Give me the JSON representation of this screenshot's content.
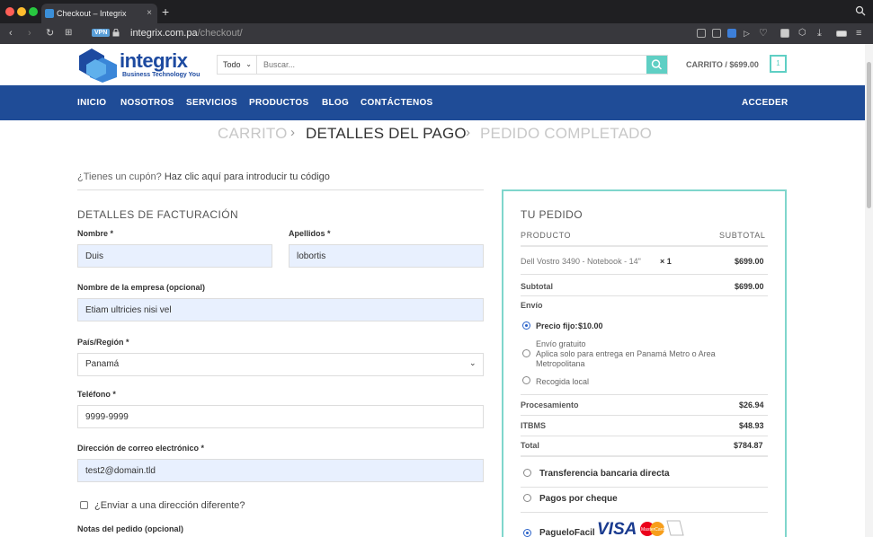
{
  "browser": {
    "tab_title": "Checkout – Integrix",
    "url_host": "integrix.com.pa",
    "url_path": "/checkout/",
    "vpn_label": "VPN"
  },
  "header": {
    "logo_text": "integrix",
    "logo_tagline": "Business Technology You",
    "search_category": "Todo",
    "search_placeholder": "Buscar...",
    "cart_label": "CARRITO / $699.00",
    "cart_count": "1"
  },
  "nav": {
    "items": [
      "INICIO",
      "NOSOTROS",
      "SERVICIOS",
      "PRODUCTOS",
      "BLOG",
      "CONTÁCTENOS"
    ],
    "login": "ACCEDER"
  },
  "steps": {
    "cart": "CARRITO",
    "details": "DETALLES DEL PAGO",
    "done": "PEDIDO COMPLETADO"
  },
  "coupon": {
    "prompt": "¿Tienes un cupón?",
    "link": "Haz clic aquí para introducir tu código"
  },
  "billing": {
    "title": "DETALLES DE FACTURACIÓN",
    "first_name_label": "Nombre *",
    "first_name": "Duis",
    "last_name_label": "Apellidos *",
    "last_name": "lobortis",
    "company_label": "Nombre de la empresa (opcional)",
    "company": "Etiam ultricies nisi vel",
    "country_label": "País/Región *",
    "country": "Panamá",
    "phone_label": "Teléfono *",
    "phone": "9999-9999",
    "email_label": "Dirección de correo electrónico *",
    "email": "test2@domain.tld",
    "ship_different": "¿Enviar a una dirección diferente?",
    "notes_label": "Notas del pedido (opcional)"
  },
  "order": {
    "title": "TU PEDIDO",
    "col_product": "PRODUCTO",
    "col_subtotal": "SUBTOTAL",
    "item_name": "Dell Vostro 3490 - Notebook - 14\"",
    "item_qty": "× 1",
    "item_price": "$699.00",
    "subtotal_label": "Subtotal",
    "subtotal": "$699.00",
    "shipping_label": "Envío",
    "ship_fixed_label": "Precio fijo:",
    "ship_fixed_price": "$10.00",
    "ship_free_label": "Envío gratuito",
    "ship_free_note": "Aplica solo para entrega en Panamá Metro o Area Metropolitana",
    "ship_pickup": "Recogida local",
    "processing_label": "Procesamiento",
    "processing": "$26.94",
    "itbms_label": "ITBMS",
    "itbms": "$48.93",
    "total_label": "Total",
    "total": "$784.87",
    "pay_bank": "Transferencia bancaria directa",
    "pay_cheque": "Pagos por cheque",
    "pay_pf": "PagueloFacil",
    "visa_text": "VISA",
    "mastercard_text": "MasterCard"
  },
  "colors": {
    "nav_blue": "#1f4c97",
    "accent_teal": "#5fcfc4",
    "autofill_blue": "#e8f0fe"
  }
}
